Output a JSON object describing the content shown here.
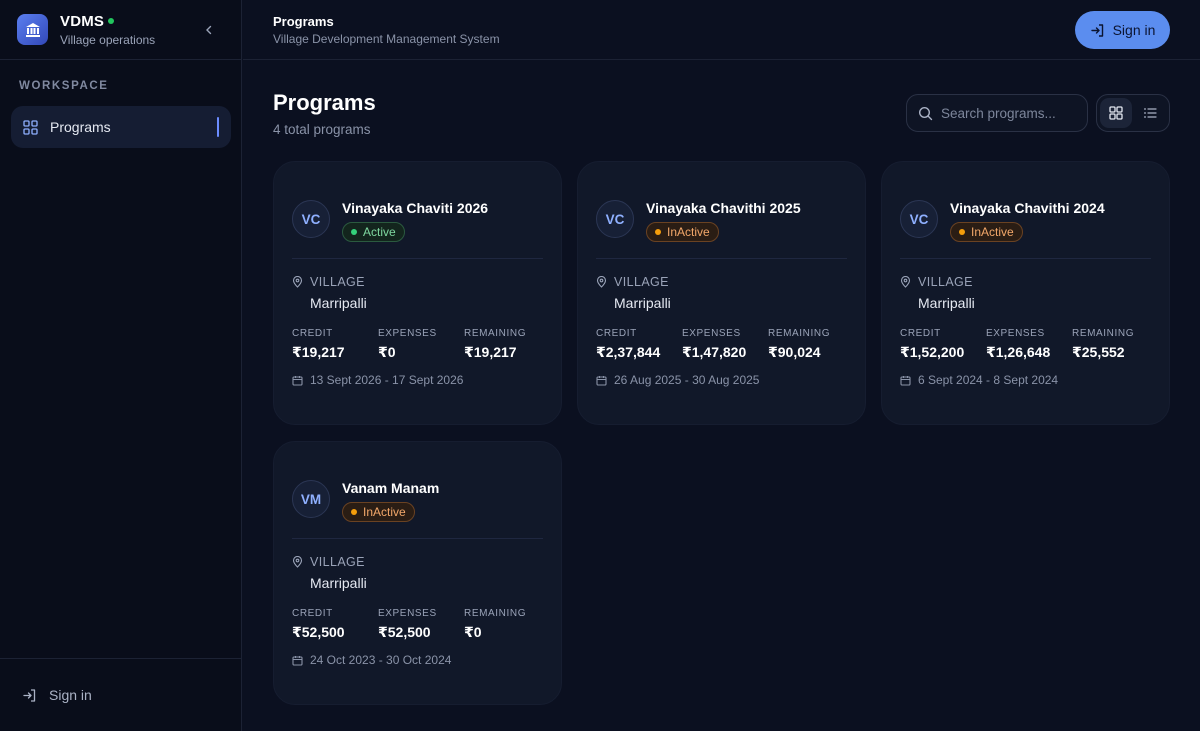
{
  "brand": {
    "title": "VDMS",
    "subtitle": "Village operations",
    "status_color": "#22c55e"
  },
  "sidebar": {
    "section_label": "WORKSPACE",
    "items": [
      {
        "label": "Programs",
        "icon": "grid-icon",
        "active": true
      }
    ],
    "footer": {
      "label": "Sign in",
      "icon": "sign-in-icon"
    }
  },
  "header": {
    "title": "Programs",
    "subtitle": "Village Development Management System",
    "signin_label": "Sign in"
  },
  "main": {
    "title": "Programs",
    "count": "4 total programs",
    "search": {
      "placeholder": "Search programs..."
    },
    "view_modes": [
      {
        "name": "grid",
        "icon": "grid-icon",
        "active": true
      },
      {
        "name": "list",
        "icon": "list-icon",
        "active": false
      }
    ]
  },
  "labels": {
    "village": "VILLAGE",
    "credit": "CREDIT",
    "expenses": "EXPENSES",
    "remaining": "REMAINING"
  },
  "programs": [
    {
      "initials": "VC",
      "name": "Vinayaka Chaviti 2026",
      "status": "Active",
      "village": "Marripalli",
      "credit": "₹19,217",
      "expenses": "₹0",
      "remaining": "₹19,217",
      "dates": "13 Sept 2026 - 17 Sept 2026"
    },
    {
      "initials": "VC",
      "name": "Vinayaka Chavithi 2025",
      "status": "InActive",
      "village": "Marripalli",
      "credit": "₹2,37,844",
      "expenses": "₹1,47,820",
      "remaining": "₹90,024",
      "dates": "26 Aug 2025 - 30 Aug 2025"
    },
    {
      "initials": "VC",
      "name": "Vinayaka Chavithi 2024",
      "status": "InActive",
      "village": "Marripalli",
      "credit": "₹1,52,200",
      "expenses": "₹1,26,648",
      "remaining": "₹25,552",
      "dates": "6 Sept 2024 - 8 Sept 2024"
    },
    {
      "initials": "VM",
      "name": "Vanam Manam",
      "status": "InActive",
      "village": "Marripalli",
      "credit": "₹52,500",
      "expenses": "₹52,500",
      "remaining": "₹0",
      "dates": "24 Oct 2023 - 30 Oct 2024"
    }
  ],
  "colors": {
    "accent": "#5b8def",
    "active": "#34d17a",
    "inactive": "#f59e0b",
    "background": "#0b1020",
    "card": "#111829"
  }
}
